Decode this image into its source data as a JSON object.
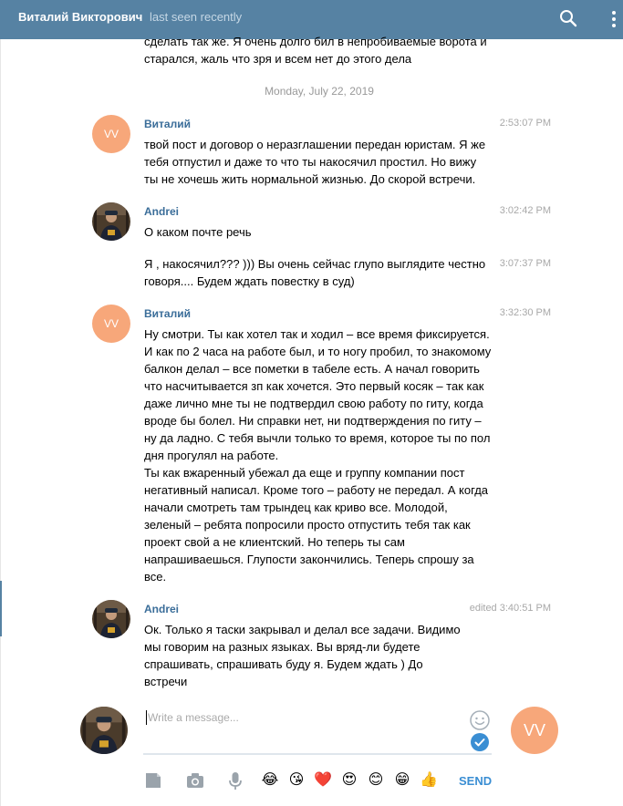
{
  "header": {
    "contact_name": "Виталий Викторович",
    "status": "last seen recently",
    "search_icon": "search-icon",
    "more_icon": "more-vertical-icon",
    "color": "#5682a3"
  },
  "chat": {
    "partial_message": [
      "сделать так же. Я очень долго бил в непробиваемые ворота и",
      "старался, жаль что зря и всем нет до этого дела"
    ],
    "date_separator": "Monday, July 22, 2019",
    "messages": [
      {
        "author": "Виталий",
        "avatar_initials": "VV",
        "time": "2:53:07 PM",
        "lines": [
          "твой пост и договор о неразглашении передан юристам. Я же",
          "тебя отпустил и даже то что ты накосячил простил. Но вижу",
          "ты не хочешь жить нормальной жизнью. До скорой встречи."
        ]
      },
      {
        "author": "Andrei",
        "time": "3:02:42 PM",
        "lines": [
          "О каком почте речь"
        ]
      },
      {
        "time": "3:07:37 PM",
        "lines": [
          "Я , накосячил??? ))) Вы очень сейчас глупо выглядите честно",
          "говоря.... Будем ждать повестку в суд)"
        ]
      },
      {
        "author": "Виталий",
        "avatar_initials": "VV",
        "time": "3:32:30 PM",
        "lines": [
          "Ну смотри. Ты как хотел так и ходил – все время фиксируется.",
          "И как по 2 часа на работе был, и то ногу пробил, то знакомому",
          "балкон делал – все пометки в табеле есть. А начал говорить",
          "что насчитывается зп как хочется. Это первый косяк – так как",
          "даже лично мне ты не подтвердил свою работу по гиту, когда",
          "вроде бы болел. Ни справки нет, ни подтверждения по гиту –",
          "ну да ладно. С тебя вычли только то время, которое ты по пол",
          "дня прогулял на работе.",
          "Ты как вжаренный убежал да еще и группу компании пост",
          "негативный написал. Кроме того – работу не передал. А когда",
          "начали смотреть там трындец как криво все. Молодой,",
          "зеленый – ребята попросили просто отпустить тебя так как",
          "проект свой а не клиентский. Но теперь ты сам",
          "напрашиваешься. Глупости закончились. Теперь спрошу за",
          "все."
        ]
      },
      {
        "author": "Andrei",
        "time": "edited 3:40:51 PM",
        "lines": [
          "Ок. Только я таски закрывал и делал все задачи. Видимо",
          "мы говорим на разных языках. Вы вряд-ли будете",
          "спрашивать, спрашивать буду я. Будем ждать ) До",
          "встречи"
        ]
      }
    ]
  },
  "composer": {
    "placeholder": "Write a message...",
    "peer_initials": "VV",
    "send_label": "SEND",
    "attach_icon": "file-icon",
    "photo_icon": "camera-icon",
    "voice_icon": "microphone-icon",
    "emoji_icon": "smile-icon",
    "check_icon": "check-circle-icon",
    "quick_emoji": [
      "😂",
      "😘",
      "❤️",
      "😍",
      "😊",
      "😁",
      "👍"
    ]
  }
}
